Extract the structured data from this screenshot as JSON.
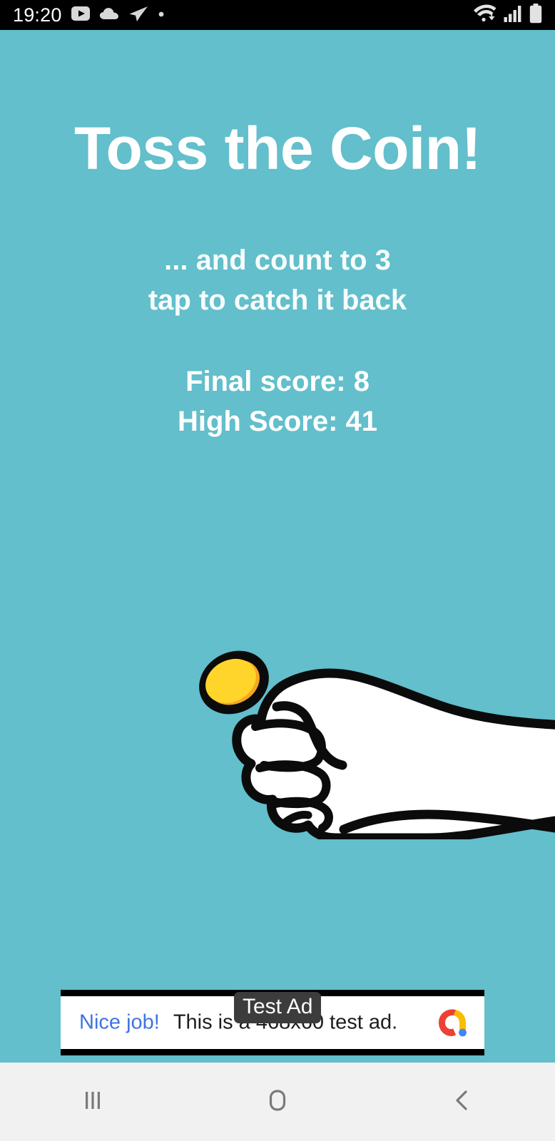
{
  "status_bar": {
    "time": "19:20",
    "left_icons": [
      "youtube-play-icon",
      "cloud-icon",
      "telegram-send-icon",
      "dot-icon"
    ],
    "right_icons": [
      "wifi-icon",
      "cellular-signal-icon",
      "battery-icon"
    ],
    "background_color": "#000000",
    "foreground_color": "#ffffff"
  },
  "app": {
    "title": "Toss the Coin!",
    "background_color": "#62bfcb",
    "text_color": "#ffffff",
    "instructions": [
      "... and count to 3",
      "tap to catch it back"
    ],
    "scores": [
      "Final score: 8",
      "High Score: 41"
    ],
    "final_score_value": "8",
    "high_score_value": "41",
    "illustration": {
      "name": "fist-holding-coin",
      "hand_fill": "#ffffff",
      "outline_color": "#000000",
      "coin_fill": "#ffd52b",
      "coin_shade": "#f5a623"
    }
  },
  "ad": {
    "badge_label": "Test Ad",
    "cta_text": "Nice job!",
    "body_text": "This is a 468x60 test ad.",
    "logo_name": "admob-logo",
    "cta_color": "#3f74e3",
    "badge_background": "#3c3c3c",
    "logo_colors": {
      "red": "#ea4335",
      "yellow": "#fbbc04",
      "blue": "#4285f4"
    }
  },
  "nav_bar": {
    "background_color": "#f1f1f1",
    "buttons": [
      {
        "name": "recents-button",
        "icon": "recents-icon"
      },
      {
        "name": "home-button",
        "icon": "home-icon"
      },
      {
        "name": "back-button",
        "icon": "back-chevron-icon"
      }
    ]
  }
}
